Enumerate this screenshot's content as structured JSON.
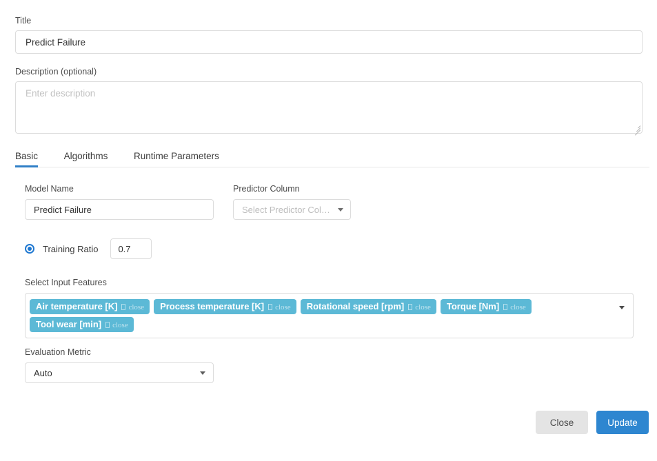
{
  "form": {
    "title_label": "Title",
    "title_value": "Predict Failure",
    "description_label": "Description (optional)",
    "description_value": "",
    "description_placeholder": "Enter description"
  },
  "tabs": [
    {
      "label": "Basic",
      "active": true
    },
    {
      "label": "Algorithms",
      "active": false
    },
    {
      "label": "Runtime Parameters",
      "active": false
    }
  ],
  "basic": {
    "model_name_label": "Model Name",
    "model_name_value": "Predict Failure",
    "predictor_column_label": "Predictor Column",
    "predictor_column_placeholder": "Select Predictor Column",
    "training_ratio_label": "Training Ratio",
    "training_ratio_value": "0.7",
    "training_ratio_selected": true,
    "input_features_label": "Select Input Features",
    "input_features": [
      {
        "label": "Air temperature [K]",
        "close_label": "close"
      },
      {
        "label": "Process temperature [K]",
        "close_label": "close"
      },
      {
        "label": "Rotational speed [rpm]",
        "close_label": "close"
      },
      {
        "label": "Torque [Nm]",
        "close_label": "close"
      },
      {
        "label": "Tool wear [min]",
        "close_label": "close"
      }
    ],
    "evaluation_metric_label": "Evaluation Metric",
    "evaluation_metric_value": "Auto"
  },
  "footer": {
    "close_label": "Close",
    "update_label": "Update"
  },
  "colors": {
    "accent_blue": "#2e86d0",
    "chip_blue": "#5cb9d6",
    "tab_underline": "#2f7fc6",
    "radio_blue": "#1f78d1",
    "secondary_button": "#e4e4e4",
    "border": "#dcdcdc"
  }
}
